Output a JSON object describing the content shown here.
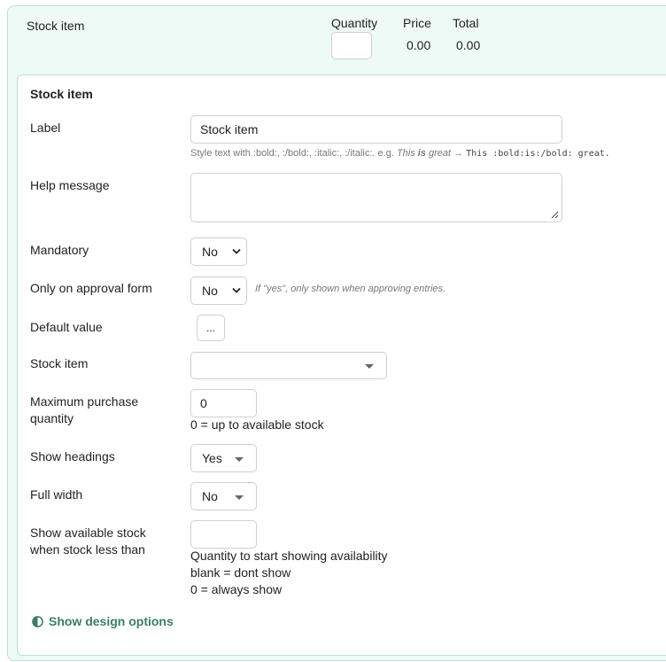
{
  "preview": {
    "label": "Stock item",
    "columns": {
      "quantity": "Quantity",
      "price": "Price",
      "total": "Total"
    },
    "price_value": "0.00",
    "total_value": "0.00"
  },
  "panel": {
    "title": "Stock item",
    "label_field": {
      "label": "Label",
      "value": "Stock item"
    },
    "style_hint": {
      "prefix": "Style text with :bold:, :/bold:, :italic:, :/italic:. e.g. ",
      "example_italic_1": "This ",
      "example_bold": "is",
      "example_italic_2": " great",
      "arrow": " → ",
      "code": "This :bold:is:/bold: great."
    },
    "help_message": {
      "label": "Help message",
      "value": ""
    },
    "mandatory": {
      "label": "Mandatory",
      "value": "No"
    },
    "approval_only": {
      "label": "Only on approval form",
      "value": "No",
      "hint": "If \"yes\", only shown when approving entries."
    },
    "default_value": {
      "label": "Default value",
      "button": "..."
    },
    "stock_item": {
      "label": "Stock item",
      "value": ""
    },
    "max_purchase": {
      "label": "Maximum purchase quantity",
      "value": "0",
      "hint": "0 = up to available stock"
    },
    "show_headings": {
      "label": "Show headings",
      "value": "Yes"
    },
    "full_width": {
      "label": "Full width",
      "value": "No"
    },
    "show_stock": {
      "label": "Show available stock when stock less than",
      "value": "",
      "hint1": "Quantity to start showing availability",
      "hint2": "blank = dont show",
      "hint3": "0 = always show"
    },
    "design_link": "Show design options"
  },
  "colors": {
    "accent": "#3b7d6a",
    "panel_bg": "#eefaf6",
    "border": "#b9e2d3"
  }
}
